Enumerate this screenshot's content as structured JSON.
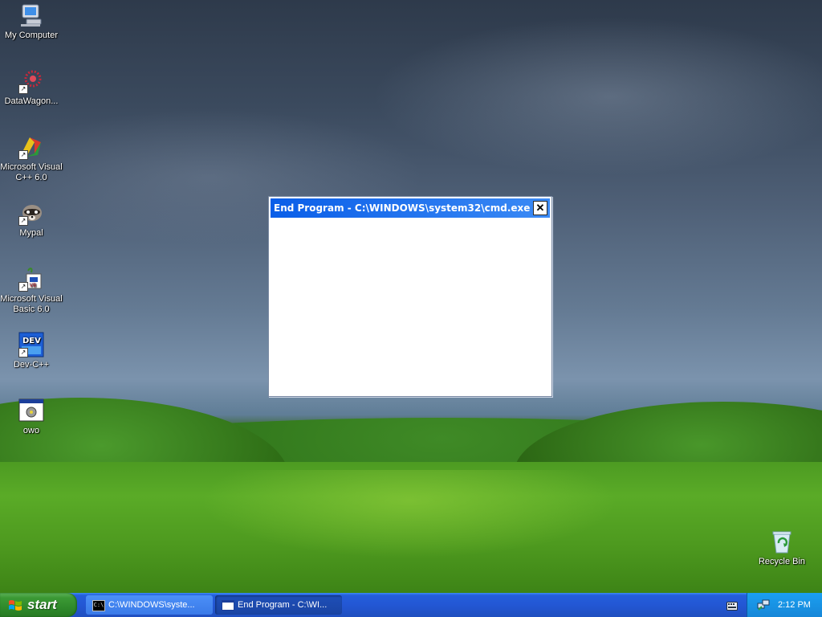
{
  "desktop": {
    "icons": [
      {
        "name": "my-computer",
        "label": "My Computer"
      },
      {
        "name": "datawagon",
        "label": "DataWagon..."
      },
      {
        "name": "visual-cpp",
        "label": "Microsoft Visual C++ 6.0"
      },
      {
        "name": "mypal",
        "label": "Mypal"
      },
      {
        "name": "visual-basic",
        "label": "Microsoft Visual Basic 6.0"
      },
      {
        "name": "dev-cpp",
        "label": "Dev-C++"
      },
      {
        "name": "owo",
        "label": "owo"
      },
      {
        "name": "recycle-bin",
        "label": "Recycle Bin"
      }
    ],
    "dev_icon_text": "DEV",
    "cmd_icon_text": "C:\\"
  },
  "dialog": {
    "title": "End Program - C:\\WINDOWS\\system32\\cmd.exe",
    "close_glyph": "✕"
  },
  "taskbar": {
    "start_label": "start",
    "tasks": [
      {
        "label": "C:\\WINDOWS\\syste...",
        "icon": "cmd-icon",
        "active": false
      },
      {
        "label": "End Program - C:\\WI...",
        "icon": "window-icon",
        "active": true
      }
    ],
    "clock": "2:12 PM"
  },
  "colors": {
    "taskbar_blue": "#245edb",
    "start_green": "#3c9a35",
    "title_blue": "#0a5ee8",
    "tray_blue": "#1b9ff0"
  }
}
